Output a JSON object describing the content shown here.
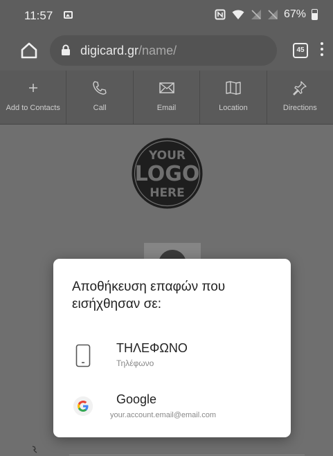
{
  "status_bar": {
    "time": "11:57",
    "battery_percent": "67%"
  },
  "browser": {
    "url_host": "digicard.gr",
    "url_path": "/name/",
    "tab_count": "45"
  },
  "actions": [
    {
      "label": "Add to Contacts",
      "icon": "plus-icon"
    },
    {
      "label": "Call",
      "icon": "phone-icon"
    },
    {
      "label": "Email",
      "icon": "envelope-icon"
    },
    {
      "label": "Location",
      "icon": "map-icon"
    },
    {
      "label": "Directions",
      "icon": "pin-icon"
    }
  ],
  "logo": {
    "line1": "YOUR",
    "line2": "LOGO",
    "line3": "HERE"
  },
  "dialog": {
    "title": "Αποθήκευση επαφών που εισήχθησαν σε:",
    "options": [
      {
        "name": "ΤΗΛΕΦΩΝΟ",
        "sub": "Τηλέφωνο",
        "icon": "phone-device-icon"
      },
      {
        "name": "Google",
        "sub": "your.account.email@email.com",
        "icon": "google-icon"
      }
    ]
  },
  "colors": {
    "scrim": "#6f6f6f",
    "dialog_bg": "#ffffff",
    "google_blue": "#4285F4",
    "google_red": "#EA4335",
    "google_yellow": "#FBBC05",
    "google_green": "#34A853"
  }
}
